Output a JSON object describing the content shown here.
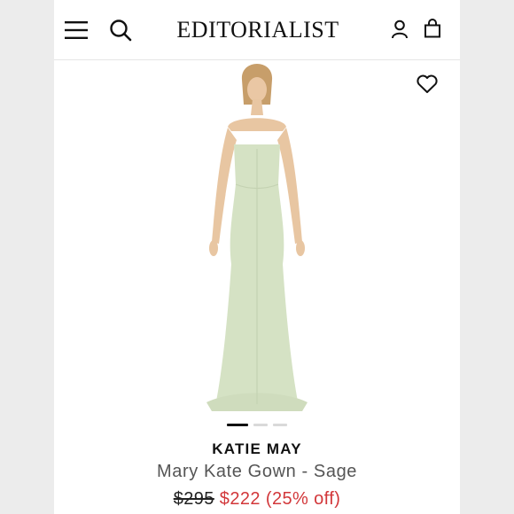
{
  "header": {
    "logo_text": "EDITORIALIST",
    "menu_icon": "hamburger-menu-icon",
    "search_icon": "search-icon",
    "account_icon": "user-icon",
    "bag_icon": "shopping-bag-icon"
  },
  "product": {
    "brand": "KATIE MAY",
    "name": "Mary Kate Gown - Sage",
    "original_price": "$295",
    "sale_price": "$222",
    "discount": "(25% off)",
    "favorite_icon": "heart-icon",
    "gallery": {
      "count": 3,
      "active_index": 0
    }
  },
  "colors": {
    "sale": "#d2373a",
    "gown": "#d5e2c4",
    "text": "#111111"
  }
}
